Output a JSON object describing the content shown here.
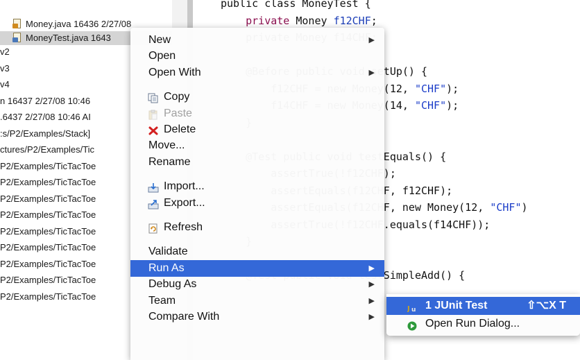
{
  "explorer": {
    "rows": [
      {
        "text": "Money.java 16436  2/27/08",
        "icon": "java-file-icon",
        "indent": true
      },
      {
        "text": "MoneyTest.java 1643",
        "icon": "junit-test-file-icon",
        "indent": true,
        "selected": true
      },
      {
        "text": "v2"
      },
      {
        "text": "v3"
      },
      {
        "text": "v4"
      },
      {
        "text": "n 16437  2/27/08 10:46"
      },
      {
        "text": ".6437  2/27/08 10:46 AI"
      },
      {
        "text": ":s/P2/Examples/Stack]"
      },
      {
        "text": "ctures/P2/Examples/Tic"
      },
      {
        "text": "P2/Examples/TicTacToe"
      },
      {
        "text": "P2/Examples/TicTacToe"
      },
      {
        "text": "P2/Examples/TicTacToe"
      },
      {
        "text": "P2/Examples/TicTacToe"
      },
      {
        "text": "P2/Examples/TicTacToe"
      },
      {
        "text": "P2/Examples/TicTacToe"
      },
      {
        "text": "P2/Examples/TicTacToe"
      },
      {
        "text": "P2/Examples/TicTacToe"
      },
      {
        "text": "P2/Examples/TicTacToe"
      }
    ]
  },
  "editor": {
    "lines": [
      {
        "indent": "",
        "parts": [
          {
            "t": "public class MoneyTest {",
            "c": "plain"
          }
        ]
      },
      {
        "indent": "    ",
        "parts": [
          {
            "t": "private",
            "c": "kw"
          },
          {
            "t": " Money ",
            "c": "plain"
          },
          {
            "t": "f12CHF",
            "c": "fld"
          },
          {
            "t": ";",
            "c": "plain"
          }
        ]
      },
      {
        "indent": "    ",
        "parts": [
          {
            "t": "private Money f14CHF;",
            "c": "plain"
          }
        ]
      },
      {
        "indent": "",
        "parts": []
      },
      {
        "indent": "    ",
        "parts": [
          {
            "t": "@Before public void setUp() {",
            "c": "plain"
          }
        ]
      },
      {
        "indent": "        ",
        "parts": [
          {
            "t": "f12CHF = new Money(12, ",
            "c": "plain"
          },
          {
            "t": "\"CHF\"",
            "c": "str"
          },
          {
            "t": ");",
            "c": "plain"
          }
        ]
      },
      {
        "indent": "        ",
        "parts": [
          {
            "t": "f14CHF = new Money(14, ",
            "c": "plain"
          },
          {
            "t": "\"CHF\"",
            "c": "str"
          },
          {
            "t": ");",
            "c": "plain"
          }
        ]
      },
      {
        "indent": "    ",
        "parts": [
          {
            "t": "}",
            "c": "plain"
          }
        ]
      },
      {
        "indent": "",
        "parts": []
      },
      {
        "indent": "    ",
        "parts": [
          {
            "t": "@Test public void testEquals() {",
            "c": "plain"
          }
        ]
      },
      {
        "indent": "        ",
        "parts": [
          {
            "t": "assertTrue(!f12CHF);",
            "c": "plain"
          }
        ]
      },
      {
        "indent": "        ",
        "parts": [
          {
            "t": "assertEquals(f12CHF, f12CHF);",
            "c": "plain"
          }
        ]
      },
      {
        "indent": "        ",
        "parts": [
          {
            "t": "assertEquals(f12CHF, new Money(12, ",
            "c": "plain"
          },
          {
            "t": "\"CHF\"",
            "c": "str"
          },
          {
            "t": ")",
            "c": "plain"
          }
        ]
      },
      {
        "indent": "        ",
        "parts": [
          {
            "t": "assertTrue(!f12CHF.equals(f14CHF));",
            "c": "plain"
          }
        ]
      },
      {
        "indent": "    ",
        "parts": [
          {
            "t": "}",
            "c": "plain"
          }
        ]
      },
      {
        "indent": "",
        "parts": []
      },
      {
        "indent": "    ",
        "parts": [
          {
            "t": "@Test public void testSimpleAdd() {",
            "c": "plain"
          }
        ]
      }
    ]
  },
  "context_menu": {
    "items": [
      {
        "type": "item",
        "label": "New",
        "submenu": true
      },
      {
        "type": "item",
        "label": "Open"
      },
      {
        "type": "item",
        "label": "Open With",
        "submenu": true
      },
      {
        "type": "sep"
      },
      {
        "type": "item",
        "label": "Copy",
        "icon": "copy-icon"
      },
      {
        "type": "item",
        "label": "Paste",
        "icon": "paste-icon",
        "disabled": true
      },
      {
        "type": "item",
        "label": "Delete",
        "icon": "delete-icon"
      },
      {
        "type": "item",
        "label": "Move..."
      },
      {
        "type": "item",
        "label": "Rename"
      },
      {
        "type": "sep"
      },
      {
        "type": "item",
        "label": "Import...",
        "icon": "import-icon"
      },
      {
        "type": "item",
        "label": "Export...",
        "icon": "export-icon"
      },
      {
        "type": "sep"
      },
      {
        "type": "item",
        "label": "Refresh",
        "icon": "refresh-icon"
      },
      {
        "type": "sep"
      },
      {
        "type": "item",
        "label": "Validate"
      },
      {
        "type": "item",
        "label": "Run As",
        "submenu": true,
        "highlight": true
      },
      {
        "type": "item",
        "label": "Debug As",
        "submenu": true
      },
      {
        "type": "item",
        "label": "Team",
        "submenu": true
      },
      {
        "type": "item",
        "label": "Compare With",
        "submenu": true
      }
    ]
  },
  "run_as_submenu": {
    "items": [
      {
        "label": "1 JUnit Test",
        "shortcut": "⇧⌥X T",
        "icon": "junit-icon",
        "highlight": true
      },
      {
        "label": "Open Run Dialog...",
        "icon": "run-icon"
      }
    ]
  },
  "colors": {
    "menu_highlight": "#3468d8",
    "keyword": "#8b0f4f",
    "field": "#1d3fb8",
    "string": "#1a3cc8"
  }
}
